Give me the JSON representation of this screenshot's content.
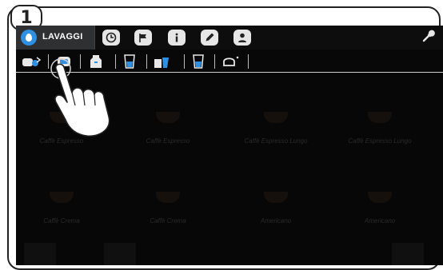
{
  "step_number": "1",
  "topbar": {
    "active_tab_label": "LAVAGGI",
    "icons": [
      "clock-icon",
      "flag-icon",
      "info-icon",
      "pencil-icon",
      "user-icon"
    ],
    "settings_icon": "wrench-icon"
  },
  "subbar": {
    "icons": [
      "cup-rinse-icon",
      "brew-group-rinse-icon",
      "milk-rinse-icon",
      "water-glass-icon",
      "milk-pitcher-icon",
      "water-glass-2-icon",
      "cleaning-icon"
    ]
  },
  "products": [
    {
      "name": "Caffè Espresso"
    },
    {
      "name": "Caffè Espresso"
    },
    {
      "name": "Caffè Espresso Lungo"
    },
    {
      "name": "Caffè Espresso Lungo"
    },
    {
      "name": "Caffè Crema"
    },
    {
      "name": "Caffè Crema"
    },
    {
      "name": "Americano"
    },
    {
      "name": "Americano"
    }
  ],
  "colors": {
    "screen_bg": "#070707",
    "accent_blue": "#2f8fe0",
    "icon_fill": "#e6e6e6"
  }
}
